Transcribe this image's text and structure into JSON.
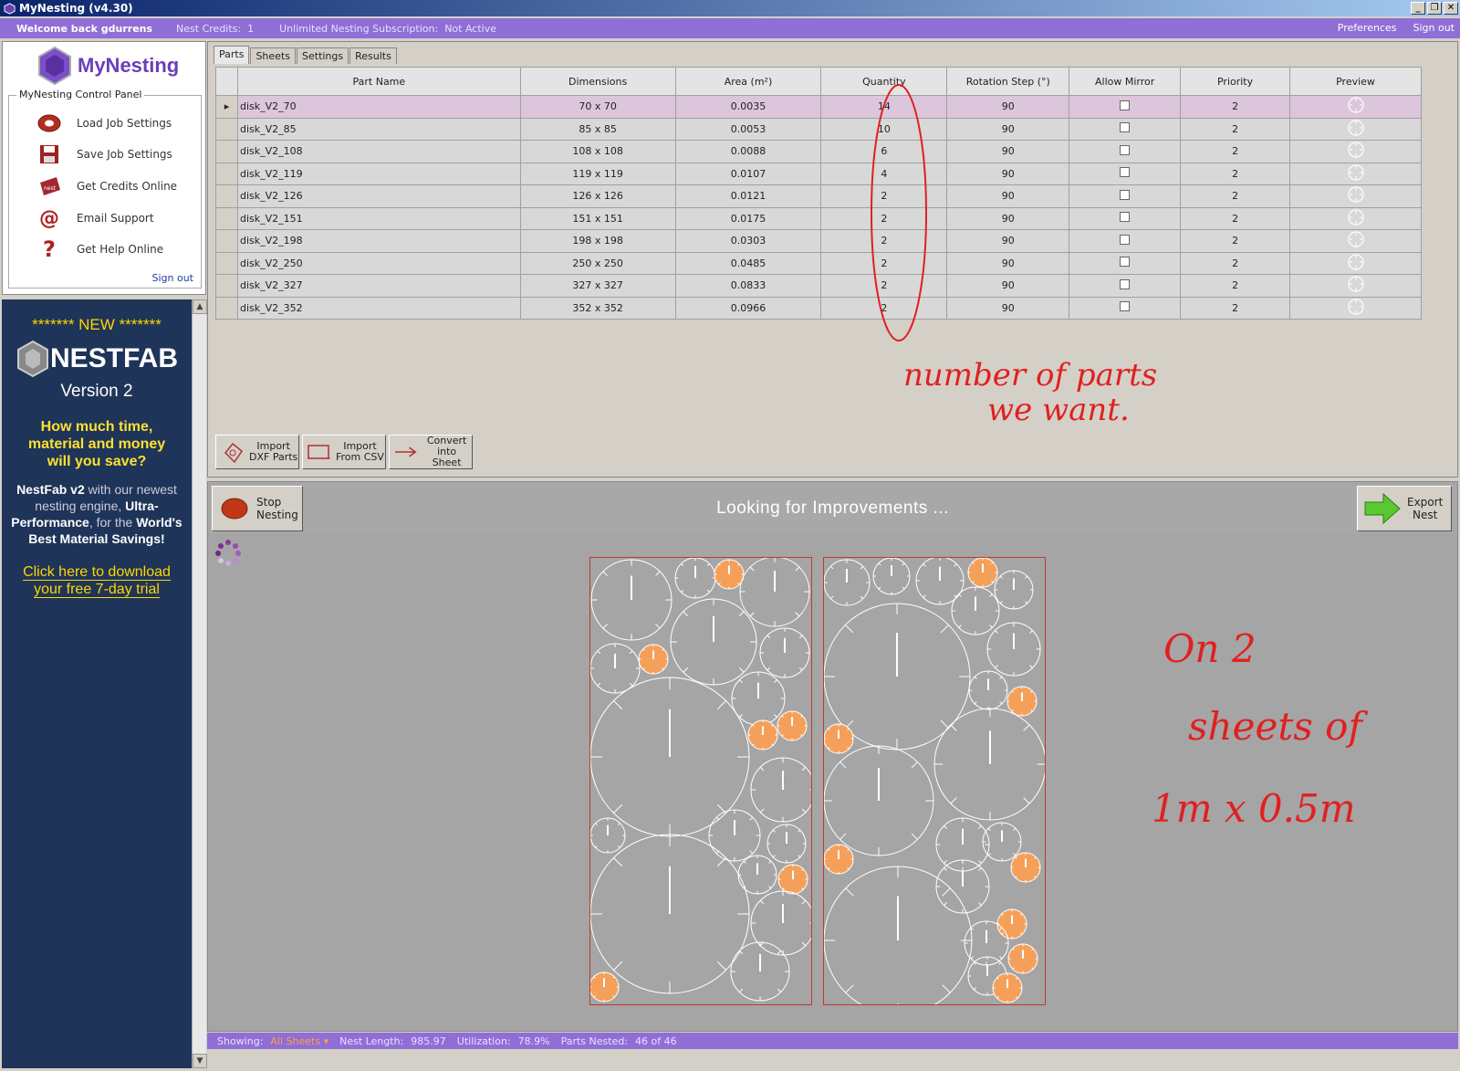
{
  "window": {
    "title": "MyNesting (v4.30)"
  },
  "topbar": {
    "welcome": "Welcome back gdurrens",
    "credits_label": "Nest Credits:",
    "credits_value": "1",
    "subscription_label": "Unlimited Nesting Subscription:",
    "subscription_value": "Not Active",
    "preferences": "Preferences",
    "signout": "Sign out"
  },
  "control_panel": {
    "logo": "MyNesting",
    "title": "MyNesting Control Panel",
    "items": [
      {
        "label": "Load Job Settings",
        "icon": "load-icon"
      },
      {
        "label": "Save Job Settings",
        "icon": "save-icon"
      },
      {
        "label": "Get Credits Online",
        "icon": "credits-icon"
      },
      {
        "label": "Email Support",
        "icon": "email-icon"
      },
      {
        "label": "Get Help Online",
        "icon": "help-icon"
      }
    ],
    "signout": "Sign out"
  },
  "ad": {
    "new": "******* NEW *******",
    "brand": "NESTFAB",
    "version": "Version 2",
    "question": [
      "How much time,",
      "material and money",
      "will you save?"
    ],
    "desc_parts": [
      "NestFab v2",
      " with our newest nesting engine, ",
      "Ultra-Performance",
      ", for the ",
      "World's Best Material Savings!"
    ],
    "cta": [
      "Click here to download",
      "your free 7-day trial"
    ]
  },
  "tabs": [
    "Parts",
    "Sheets",
    "Settings",
    "Results"
  ],
  "grid": {
    "headers": [
      "Part Name",
      "Dimensions",
      "Area (m²)",
      "Quantity",
      "Rotation Step (°)",
      "Allow Mirror",
      "Priority",
      "Preview"
    ],
    "rows": [
      {
        "name": "disk_V2_70",
        "dim": "70 x 70",
        "area": "0.0035",
        "qty": "14",
        "rot": "90",
        "pri": "2"
      },
      {
        "name": "disk_V2_85",
        "dim": "85 x 85",
        "area": "0.0053",
        "qty": "10",
        "rot": "90",
        "pri": "2"
      },
      {
        "name": "disk_V2_108",
        "dim": "108 x 108",
        "area": "0.0088",
        "qty": "6",
        "rot": "90",
        "pri": "2"
      },
      {
        "name": "disk_V2_119",
        "dim": "119 x 119",
        "area": "0.0107",
        "qty": "4",
        "rot": "90",
        "pri": "2"
      },
      {
        "name": "disk_V2_126",
        "dim": "126 x 126",
        "area": "0.0121",
        "qty": "2",
        "rot": "90",
        "pri": "2"
      },
      {
        "name": "disk_V2_151",
        "dim": "151 x 151",
        "area": "0.0175",
        "qty": "2",
        "rot": "90",
        "pri": "2"
      },
      {
        "name": "disk_V2_198",
        "dim": "198 x 198",
        "area": "0.0303",
        "qty": "2",
        "rot": "90",
        "pri": "2"
      },
      {
        "name": "disk_V2_250",
        "dim": "250 x 250",
        "area": "0.0485",
        "qty": "2",
        "rot": "90",
        "pri": "2"
      },
      {
        "name": "disk_V2_327",
        "dim": "327 x 327",
        "area": "0.0833",
        "qty": "2",
        "rot": "90",
        "pri": "2"
      },
      {
        "name": "disk_V2_352",
        "dim": "352 x 352",
        "area": "0.0966",
        "qty": "2",
        "rot": "90",
        "pri": "2"
      }
    ]
  },
  "buttons": {
    "import_dxf": [
      "Import",
      "DXF Parts"
    ],
    "import_csv": [
      "Import",
      "From CSV"
    ],
    "convert": [
      "Convert",
      "into Sheet"
    ],
    "stop": [
      "Stop",
      "Nesting"
    ],
    "export": [
      "Export",
      "Nest"
    ]
  },
  "nest": {
    "status": "Looking for Improvements ..."
  },
  "annotations": {
    "qty_note": [
      "number of parts",
      "we want."
    ],
    "sheet_note": [
      "On 2",
      "sheets of",
      "1m x 0.5m"
    ]
  },
  "statusbar": {
    "showing_label": "Showing:",
    "showing_value": "All Sheets",
    "length_label": "Nest Length:",
    "length_value": "985.97",
    "util_label": "Utilization:",
    "util_value": "78.9%",
    "parts_label": "Parts Nested:",
    "parts_value": "46 of 46"
  },
  "colors": {
    "accent": "#8f6fd6",
    "sheet_border": "#c0392b",
    "small_part": "#f5a05a",
    "annotation": "#e02020"
  }
}
